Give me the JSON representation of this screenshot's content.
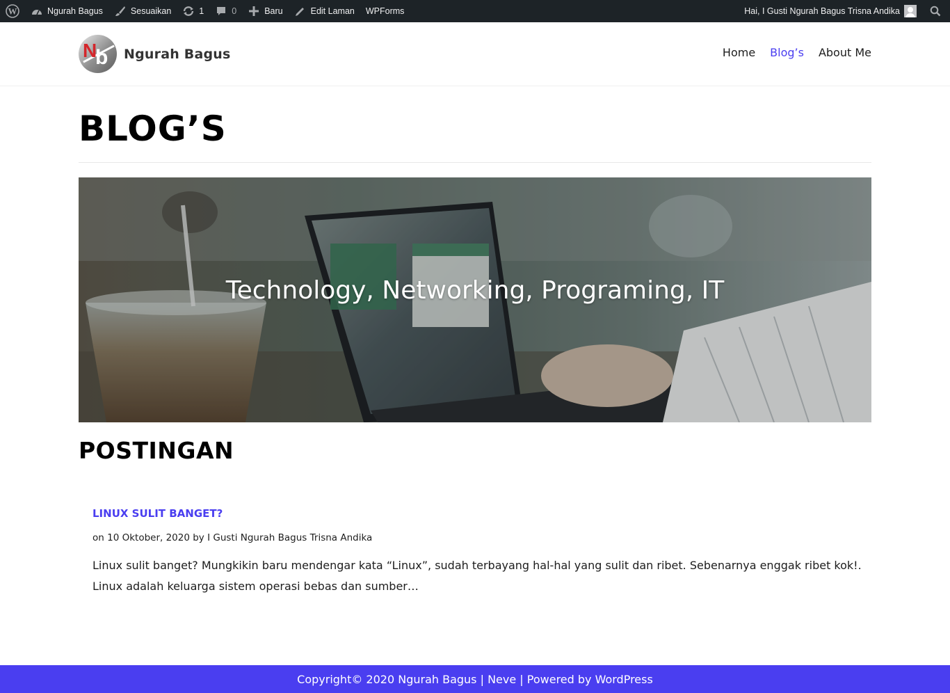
{
  "adminbar": {
    "site": "Ngurah Bagus",
    "customize": "Sesuaikan",
    "updates_count": "1",
    "comments_count": "0",
    "new": "Baru",
    "edit_page": "Edit Laman",
    "wpforms": "WPForms",
    "greeting": "Hai, I Gusti Ngurah Bagus Trisna Andika"
  },
  "header": {
    "brand_name": "Ngurah Bagus",
    "logo_letters": "Nb",
    "nav": [
      "Home",
      "Blog’s",
      "About Me"
    ],
    "active_nav": "Blog’s"
  },
  "main": {
    "page_title": "BLOG’S",
    "hero_caption": "Technology, Networking, Programing, IT",
    "section_title": "POSTINGAN",
    "post": {
      "title": "LINUX SULIT BANGET?",
      "meta_prefix": "on 10 Oktober, 2020 by ",
      "author": "I Gusti Ngurah Bagus Trisna Andika",
      "excerpt": "Linux sulit banget? Mungkikin baru mendengar kata “Linux”, sudah terbayang hal-hal yang sulit dan ribet. Sebenarnya enggak ribet kok!. Linux adalah keluarga sistem operasi bebas dan sumber…"
    }
  },
  "footer": {
    "copyright": "Copyright© 2020 Ngurah Bagus",
    "sep": " | ",
    "theme": "Neve",
    "powered": "Powered by WordPress"
  },
  "colors": {
    "accent": "#4a3ef0",
    "adminbar": "#1d2327"
  }
}
